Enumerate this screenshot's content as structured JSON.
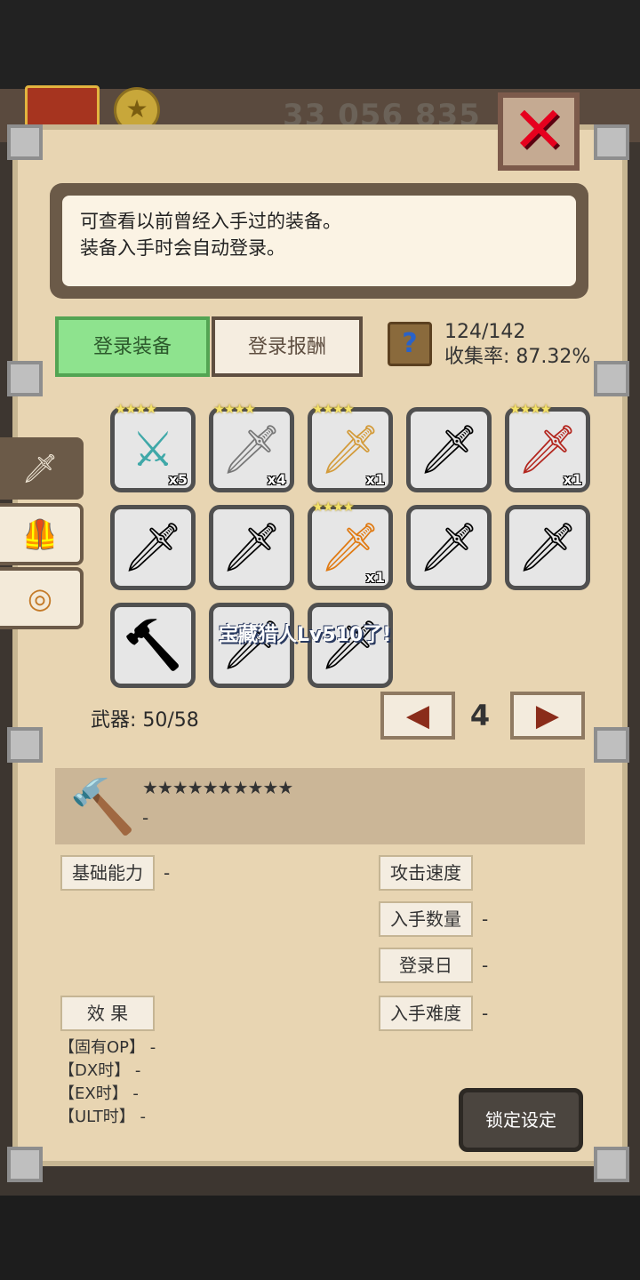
{
  "header": {
    "gold": "33 056 835",
    "close_icon": "close-x-icon"
  },
  "info": {
    "line1": "可查看以前曾经入手过的装备。",
    "line2": "装备入手时会自动登录。"
  },
  "tabs": [
    {
      "label": "登录装备",
      "active": true
    },
    {
      "label": "登录报酬",
      "active": false
    }
  ],
  "collection": {
    "count": "124/142",
    "rate": "收集率: 87.32%"
  },
  "side_tabs": [
    "sword-icon",
    "armor-icon",
    "ring-icon"
  ],
  "grid": [
    {
      "icon": "⚔",
      "qty": "x5",
      "stars": "★★★★",
      "owned": true,
      "color": "#3fa8a8"
    },
    {
      "icon": "🗡",
      "qty": "x4",
      "stars": "★★★★",
      "owned": true,
      "color": "#777"
    },
    {
      "icon": "🗡",
      "qty": "x1",
      "stars": "★★★★",
      "owned": true,
      "color": "#d39b3a"
    },
    {
      "icon": "🗡",
      "qty": "",
      "stars": "",
      "owned": false,
      "color": "#000"
    },
    {
      "icon": "🗡",
      "qty": "x1",
      "stars": "★★★★",
      "owned": true,
      "color": "#b3261e"
    },
    {
      "icon": "🗡",
      "qty": "",
      "stars": "",
      "owned": false,
      "color": "#000"
    },
    {
      "icon": "🗡",
      "qty": "",
      "stars": "",
      "owned": false,
      "color": "#000"
    },
    {
      "icon": "🗡",
      "qty": "x1",
      "stars": "★★★★",
      "owned": true,
      "color": "#e07a12"
    },
    {
      "icon": "🗡",
      "qty": "",
      "stars": "",
      "owned": false,
      "color": "#000"
    },
    {
      "icon": "🗡",
      "qty": "",
      "stars": "",
      "owned": false,
      "color": "#000"
    },
    {
      "icon": "🔨",
      "qty": "",
      "stars": "",
      "owned": false,
      "color": "#000"
    },
    {
      "icon": "🗡",
      "qty": "",
      "stars": "",
      "owned": false,
      "color": "#000"
    },
    {
      "icon": "🗡",
      "qty": "",
      "stars": "",
      "owned": false,
      "color": "#000"
    }
  ],
  "notice": "宝藏猎人Lv510了!",
  "weapons": "武器: 50/58",
  "page": {
    "number": "4",
    "prev": "◀",
    "next": "▶"
  },
  "detail": {
    "stars": "★★★★★★★★★★",
    "name": "-"
  },
  "stats": {
    "base_label": "基础能力",
    "base_value": "-",
    "speed_label": "攻击速度",
    "speed_value": "",
    "qty_label": "入手数量",
    "qty_value": "-",
    "date_label": "登录日",
    "date_value": "-",
    "effect_label": "效 果",
    "difficulty_label": "入手难度",
    "difficulty_value": "-"
  },
  "ops": [
    "【固有OP】 -",
    "【DX时】 -",
    "【EX时】 -",
    "【ULT时】 -"
  ],
  "lock_button": "锁定设定"
}
